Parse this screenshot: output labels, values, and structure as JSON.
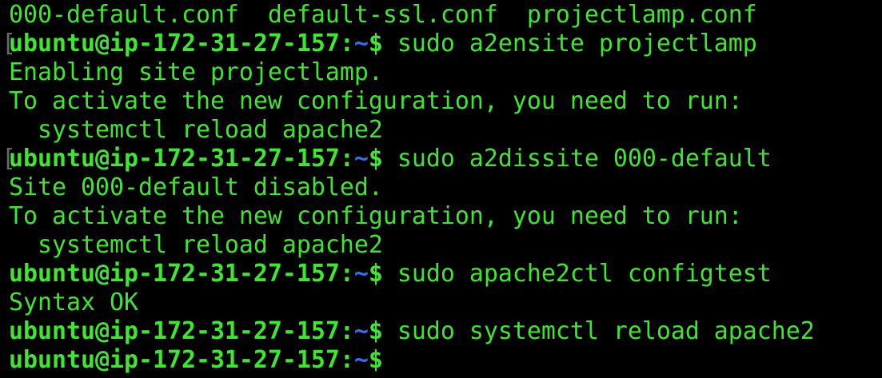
{
  "colors": {
    "background": "#000000",
    "text": "#3ee62f",
    "path": "#3b6df0",
    "bracket": "#6a6a6a"
  },
  "prompt": {
    "user_host": "ubuntu@ip-172-31-27-157",
    "colon": ":",
    "path": "~",
    "symbol": "$"
  },
  "lines": [
    {
      "type": "output",
      "text": "000-default.conf  default-ssl.conf  projectlamp.conf"
    },
    {
      "type": "prompt",
      "bracket": "[",
      "command": " sudo a2ensite projectlamp"
    },
    {
      "type": "output",
      "text": "Enabling site projectlamp."
    },
    {
      "type": "output",
      "text": "To activate the new configuration, you need to run:"
    },
    {
      "type": "output",
      "text": "  systemctl reload apache2"
    },
    {
      "type": "prompt",
      "bracket": "[",
      "command": " sudo a2dissite 000-default"
    },
    {
      "type": "output",
      "text": "Site 000-default disabled."
    },
    {
      "type": "output",
      "text": "To activate the new configuration, you need to run:"
    },
    {
      "type": "output",
      "text": "  systemctl reload apache2"
    },
    {
      "type": "prompt",
      "bracket": "",
      "command": " sudo apache2ctl configtest"
    },
    {
      "type": "output",
      "text": "Syntax OK"
    },
    {
      "type": "prompt",
      "bracket": "",
      "command": " sudo systemctl reload apache2"
    },
    {
      "type": "prompt",
      "bracket": "",
      "command": ""
    }
  ]
}
